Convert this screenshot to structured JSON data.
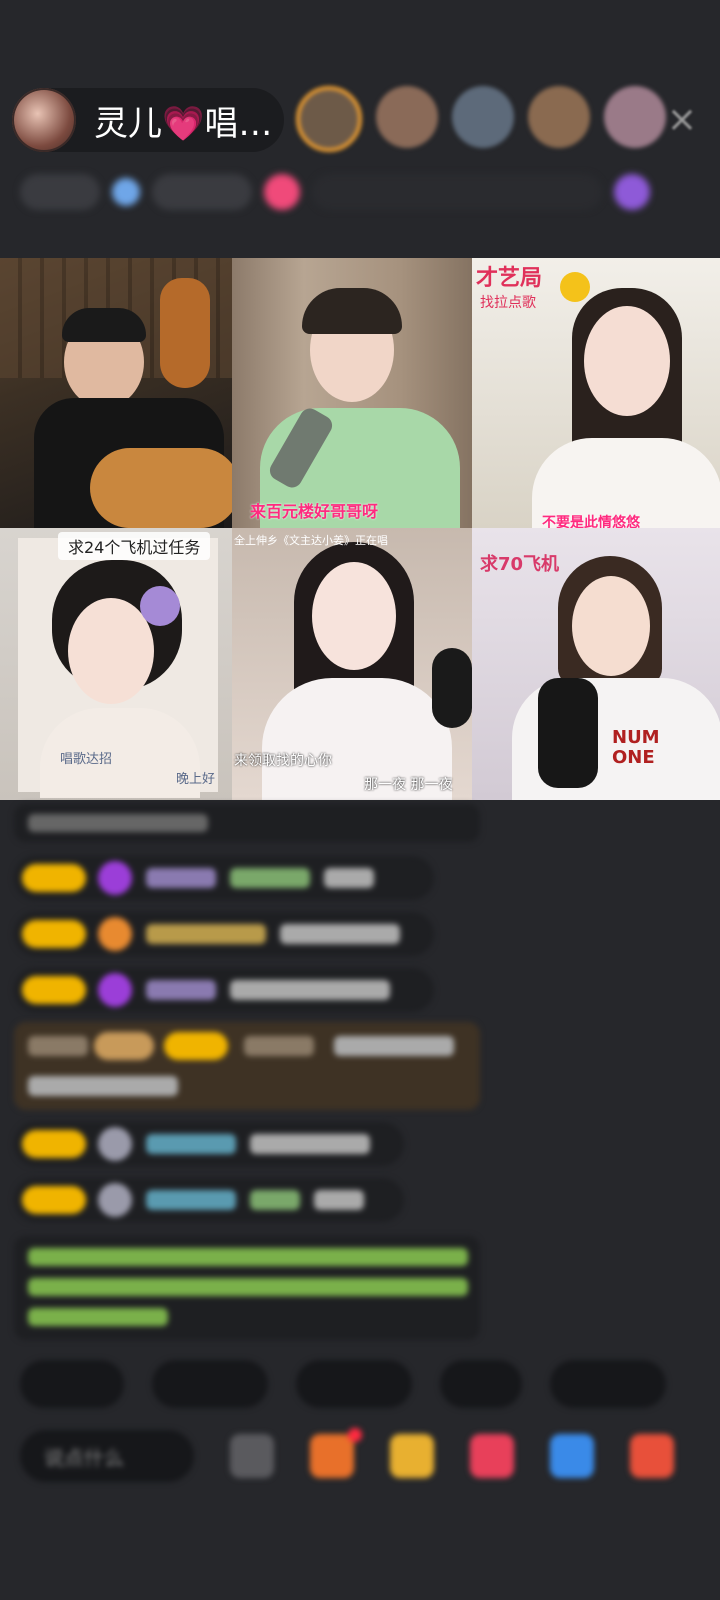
{
  "host": {
    "name": "灵儿💗唱…",
    "avatar_icon": "host-avatar"
  },
  "viewers": [
    "viewer-avatar-1",
    "viewer-avatar-2",
    "viewer-avatar-3",
    "viewer-avatar-4",
    "viewer-avatar-5"
  ],
  "close_icon": "×",
  "stats": {
    "blurred_labels": [
      "",
      "",
      "",
      ""
    ]
  },
  "grid": {
    "cells": [
      {
        "id": "guitarist",
        "caption": ""
      },
      {
        "id": "mic-girl",
        "caption": "来百元楼好哥哥呀"
      },
      {
        "id": "caiyiju",
        "tag": "才艺局",
        "subtag": "找拉点歌",
        "caption": "不要是此情悠悠"
      },
      {
        "id": "portrait",
        "tag": "求24个飞机过任务",
        "caption_left": "唱歌达招",
        "caption_right": "晚上好"
      },
      {
        "id": "white-dress",
        "top_caption": "全上伸乡《文主达小姜》正在唱",
        "caption_left": "来领取找的心你",
        "caption_right": "那一夜 那一夜"
      },
      {
        "id": "numb-shirt",
        "tag": "求70飞机"
      }
    ]
  },
  "chat": {
    "messages": [
      {
        "type": "system",
        "text": "欢迎，刷新你页"
      },
      {
        "type": "user",
        "badge": "",
        "avatar": "diamond",
        "name": "",
        "text": ""
      },
      {
        "type": "user",
        "badge": "",
        "avatar": "orange",
        "name": "",
        "text": ""
      },
      {
        "type": "user",
        "badge": "",
        "avatar": "diamond",
        "name": "",
        "text": ""
      },
      {
        "type": "gift",
        "text": ""
      },
      {
        "type": "user",
        "badge": "",
        "avatar": "gray",
        "name": "",
        "text": ""
      },
      {
        "type": "user",
        "badge": "",
        "avatar": "gray",
        "name": "",
        "text": ""
      },
      {
        "type": "notice",
        "text": ""
      }
    ]
  },
  "quick_chips": [
    "",
    "",
    "",
    "",
    ""
  ],
  "bottom": {
    "input_placeholder": "说点什么",
    "icons": [
      "emoji-icon",
      "gift-box-icon",
      "treasure-icon",
      "heart-gift-icon",
      "wallet-icon",
      "more-icon"
    ]
  },
  "colors": {
    "background": "#26272b",
    "badge": "#f0b400",
    "accent_pink": "#ff2a7f",
    "green_text": "#9ad35a"
  }
}
